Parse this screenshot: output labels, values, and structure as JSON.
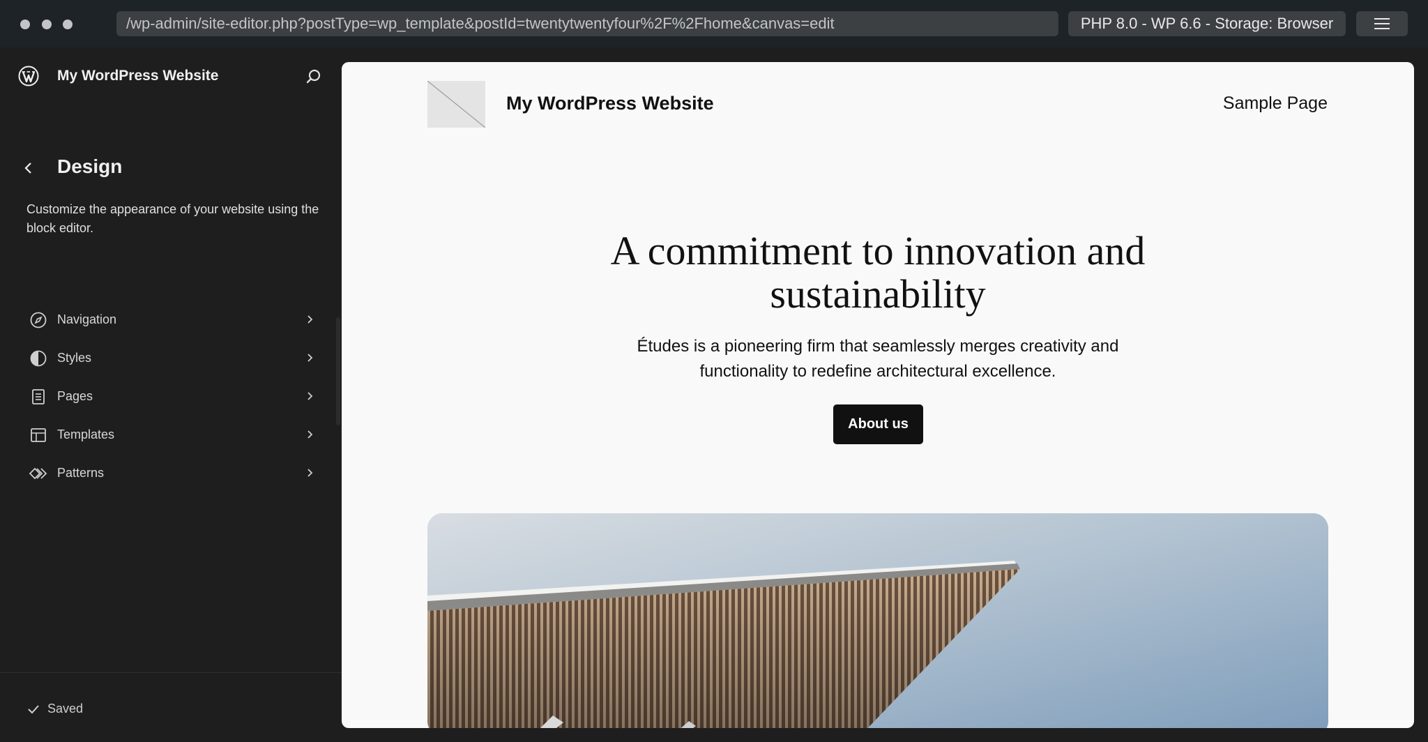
{
  "browser": {
    "url": "/wp-admin/site-editor.php?postType=wp_template&postId=twentytwentyfour%2F%2Fhome&canvas=edit",
    "environment": "PHP 8.0 - WP 6.6 - Storage: Browser",
    "menu_icon": "hamburger-icon"
  },
  "sidebar": {
    "site_title": "My WordPress Website",
    "section_title": "Design",
    "description": "Customize the appearance of your website using the block editor.",
    "items": [
      {
        "label": "Navigation",
        "icon": "navigation-icon"
      },
      {
        "label": "Styles",
        "icon": "styles-icon"
      },
      {
        "label": "Pages",
        "icon": "pages-icon"
      },
      {
        "label": "Templates",
        "icon": "templates-icon"
      },
      {
        "label": "Patterns",
        "icon": "patterns-icon"
      }
    ],
    "status": "Saved"
  },
  "canvas": {
    "site_title": "My WordPress Website",
    "nav_link": "Sample Page",
    "hero_title": "A commitment to innovation and sustainability",
    "hero_text": "Études is a pioneering firm that seamlessly merges creativity and functionality to redefine architectural excellence.",
    "button_label": "About us"
  },
  "colors": {
    "chrome_bg": "#1d2327",
    "sidebar_bg": "#1e1e1e",
    "canvas_bg": "#f9f9f9",
    "button_bg": "#111111"
  }
}
